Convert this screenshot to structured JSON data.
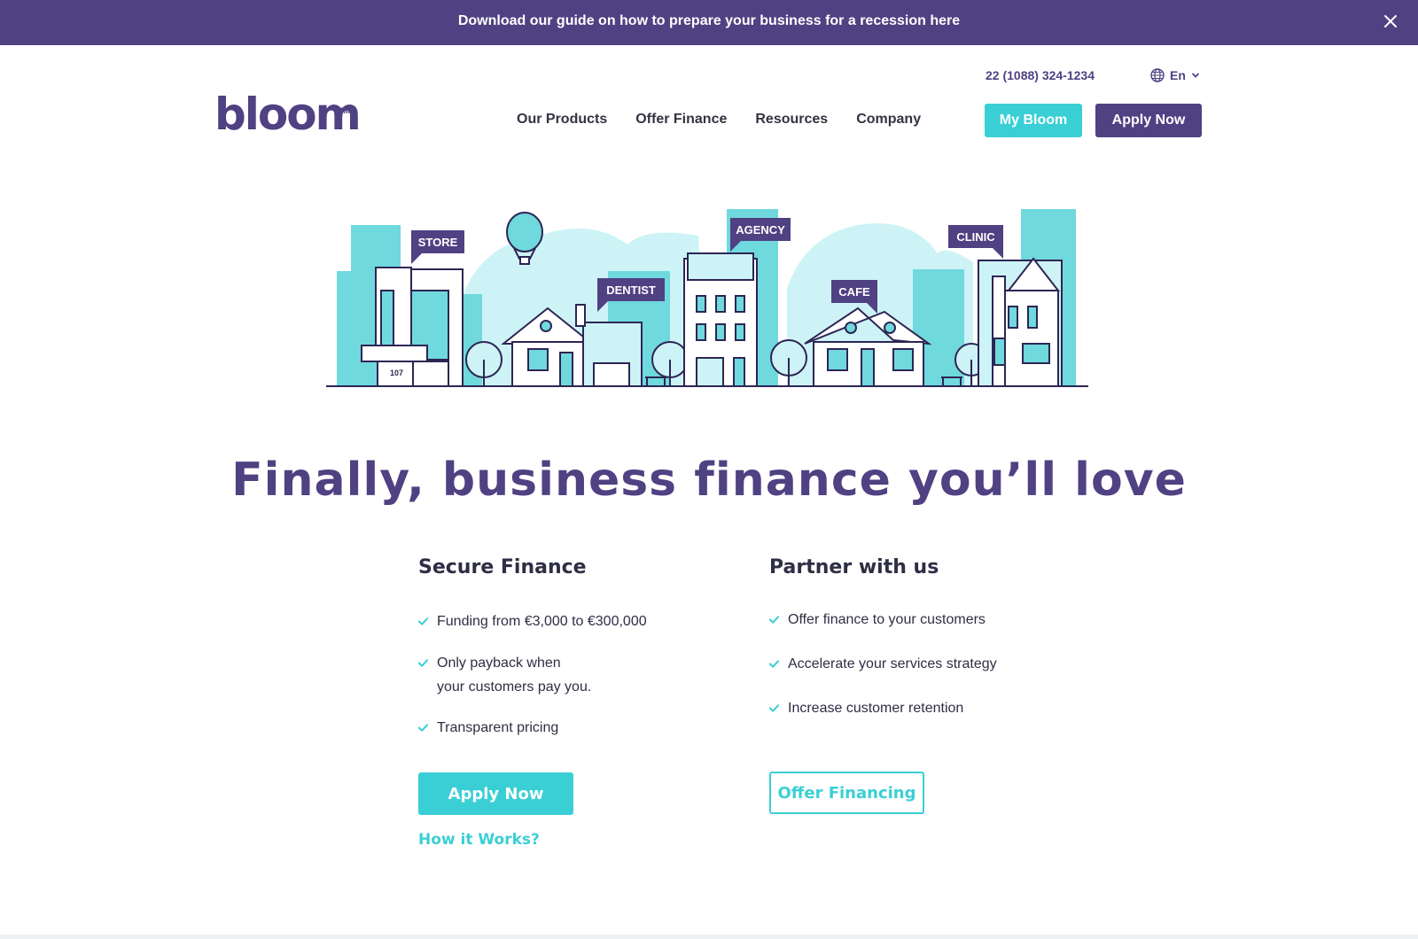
{
  "banner": {
    "text": "Download our guide on how to prepare your business for a recession here",
    "close_icon": "close-icon"
  },
  "topbar": {
    "phone": "22 (1088) 324-1234",
    "language": "En",
    "globe_icon": "globe-icon",
    "chevron_icon": "chevron-down-icon"
  },
  "logo": {
    "text": "bloom",
    "tm": "TM"
  },
  "nav": {
    "items": [
      {
        "label": "Our Products"
      },
      {
        "label": "Offer Finance"
      },
      {
        "label": "Resources"
      },
      {
        "label": "Company"
      }
    ]
  },
  "header_buttons": {
    "my_bloom": "My Bloom",
    "apply_now": "Apply Now"
  },
  "illustration": {
    "labels": {
      "store": "STORE",
      "dentist": "DENTIST",
      "agency": "AGENCY",
      "cafe": "CAFE",
      "clinic": "CLINIC"
    },
    "house_number": "107"
  },
  "hero": {
    "title": "Finally, business finance you’ll love"
  },
  "secure": {
    "heading": "Secure Finance",
    "features": [
      {
        "line1": "Funding from €3,000 to €300,000",
        "line2": ""
      },
      {
        "line1": "Only payback when",
        "line2": "your customers pay you."
      },
      {
        "line1": "Transparent pricing",
        "line2": ""
      }
    ],
    "apply_label": "Apply Now",
    "how_label": "How it Works?"
  },
  "partner": {
    "heading": "Partner with us",
    "features": [
      {
        "line1": "Offer finance to your customers"
      },
      {
        "line1": "Accelerate your services strategy"
      },
      {
        "line1": "Increase customer retention"
      }
    ],
    "offer_label": "Offer Financing"
  },
  "colors": {
    "purple": "#4f4182",
    "teal": "#3acfd5",
    "light_teal": "#cdf3f6",
    "text": "#2e2e44"
  }
}
